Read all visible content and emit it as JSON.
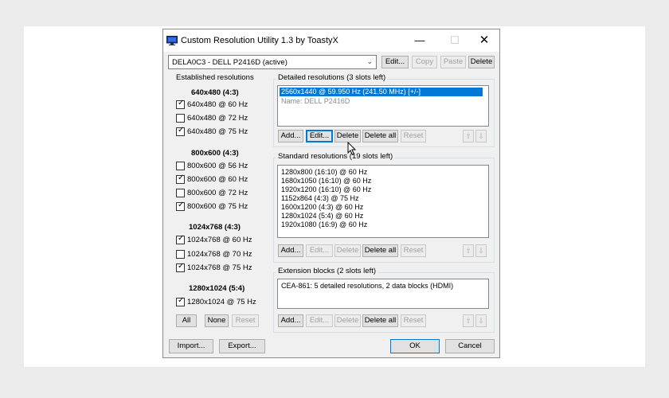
{
  "window": {
    "title": "Custom Resolution Utility 1.3 by ToastyX",
    "controls": {
      "minimize": "—",
      "maximize": "☐",
      "close": "✕"
    }
  },
  "monitor_select": {
    "value": "DELA0C3 - DELL P2416D (active)"
  },
  "top_buttons": {
    "edit": "Edit...",
    "copy": "Copy",
    "paste": "Paste",
    "delete": "Delete"
  },
  "established": {
    "title": "Established resolutions",
    "groups": [
      {
        "heading": "640x480 (4:3)",
        "items": [
          {
            "label": "640x480 @ 60 Hz",
            "checked": true
          },
          {
            "label": "640x480 @ 72 Hz",
            "checked": false
          },
          {
            "label": "640x480 @ 75 Hz",
            "checked": true
          }
        ]
      },
      {
        "heading": "800x600 (4:3)",
        "items": [
          {
            "label": "800x600 @ 56 Hz",
            "checked": false
          },
          {
            "label": "800x600 @ 60 Hz",
            "checked": true
          },
          {
            "label": "800x600 @ 72 Hz",
            "checked": false
          },
          {
            "label": "800x600 @ 75 Hz",
            "checked": true
          }
        ]
      },
      {
        "heading": "1024x768 (4:3)",
        "items": [
          {
            "label": "1024x768 @ 60 Hz",
            "checked": true
          },
          {
            "label": "1024x768 @ 70 Hz",
            "checked": false
          },
          {
            "label": "1024x768 @ 75 Hz",
            "checked": true
          }
        ]
      },
      {
        "heading": "1280x1024 (5:4)",
        "items": [
          {
            "label": "1280x1024 @ 75 Hz",
            "checked": true
          }
        ]
      }
    ],
    "buttons": {
      "all": "All",
      "none": "None",
      "reset": "Reset"
    }
  },
  "detailed": {
    "title": "Detailed resolutions (3 slots left)",
    "items": [
      "2560x1440 @ 59.950 Hz (241.50 MHz) [+/-]",
      "Name: DELL P2416D"
    ],
    "buttons": {
      "add": "Add...",
      "edit": "Edit...",
      "delete": "Delete",
      "delete_all": "Delete all",
      "reset": "Reset",
      "up": "⇧",
      "down": "⇩"
    }
  },
  "standard": {
    "title": "Standard resolutions (19 slots left)",
    "items": [
      "1280x800 (16:10) @ 60 Hz",
      "1680x1050 (16:10) @ 60 Hz",
      "1920x1200 (16:10) @ 60 Hz",
      "1152x864 (4:3) @ 75 Hz",
      "1600x1200 (4:3) @ 60 Hz",
      "1280x1024 (5:4) @ 60 Hz",
      "1920x1080 (16:9) @ 60 Hz"
    ],
    "buttons": {
      "add": "Add...",
      "edit": "Edit...",
      "delete": "Delete",
      "delete_all": "Delete all",
      "reset": "Reset",
      "up": "⇧",
      "down": "⇩"
    }
  },
  "extension": {
    "title": "Extension blocks (2 slots left)",
    "items": [
      "CEA-861: 5 detailed resolutions, 2 data blocks (HDMI)"
    ],
    "buttons": {
      "add": "Add...",
      "edit": "Edit...",
      "delete": "Delete",
      "delete_all": "Delete all",
      "reset": "Reset",
      "up": "⇧",
      "down": "⇩"
    }
  },
  "footer": {
    "import": "Import...",
    "export": "Export...",
    "ok": "OK",
    "cancel": "Cancel"
  }
}
